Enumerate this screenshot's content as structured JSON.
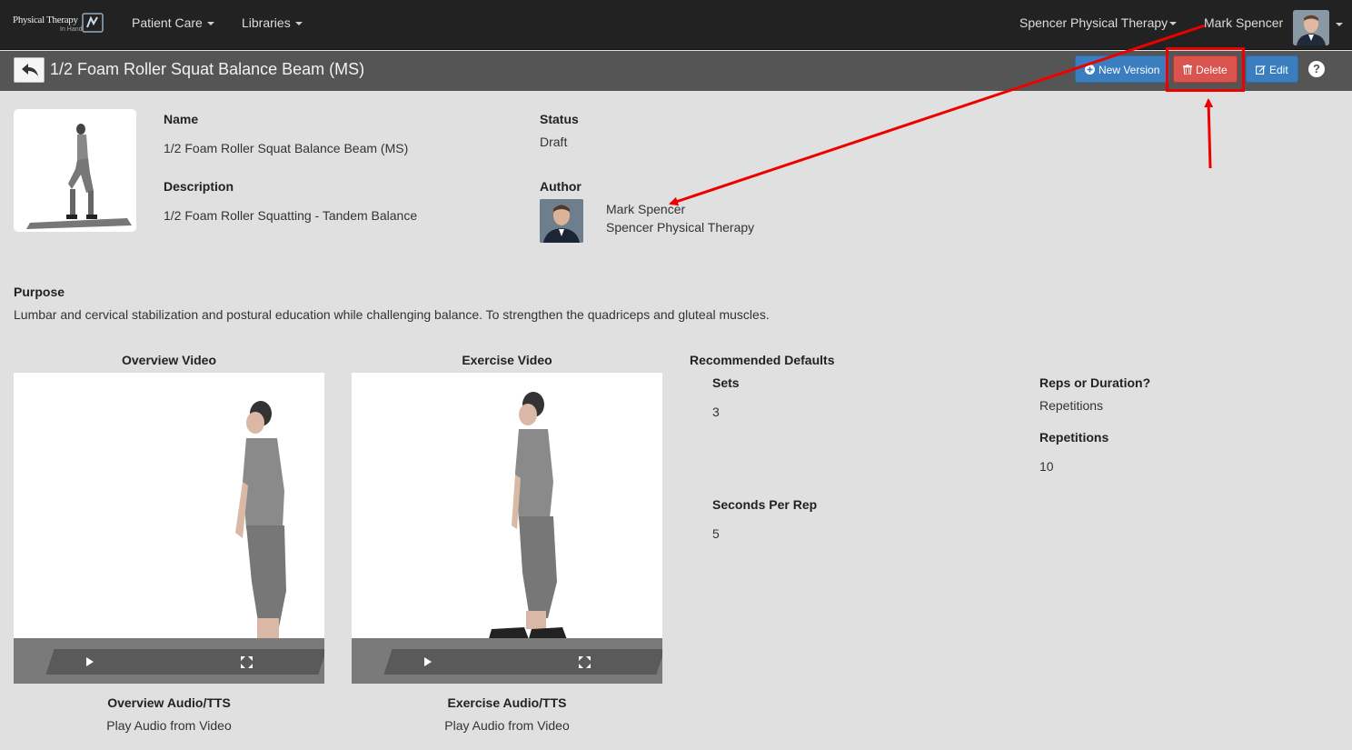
{
  "navbar": {
    "logo_text": "Physical Therapy",
    "logo_sub": "In Hand",
    "patient_care": "Patient Care",
    "libraries": "Libraries",
    "clinic": "Spencer Physical Therapy",
    "user": "Mark Spencer"
  },
  "titlebar": {
    "title": "1/2 Foam Roller Squat Balance Beam (MS)",
    "new_version": "New Version",
    "delete": "Delete",
    "edit": "Edit",
    "help": "?"
  },
  "details": {
    "name_label": "Name",
    "name_value": "1/2 Foam Roller Squat Balance Beam (MS)",
    "description_label": "Description",
    "description_value": "1/2 Foam Roller Squatting - Tandem Balance",
    "status_label": "Status",
    "status_value": "Draft",
    "author_label": "Author",
    "author_name": "Mark Spencer",
    "author_org": "Spencer Physical Therapy"
  },
  "purpose": {
    "label": "Purpose",
    "text": "Lumbar and cervical stabilization and postural education while challenging balance. To strengthen the quadriceps and gluteal muscles."
  },
  "videos": {
    "overview_title": "Overview Video",
    "exercise_title": "Exercise Video",
    "overview_audio_label": "Overview Audio/TTS",
    "overview_audio_value": "Play Audio from Video",
    "exercise_audio_label": "Exercise Audio/TTS",
    "exercise_audio_value": "Play Audio from Video"
  },
  "defaults": {
    "title": "Recommended Defaults",
    "sets_label": "Sets",
    "sets_value": "3",
    "seconds_label": "Seconds Per Rep",
    "seconds_value": "5",
    "reps_or_duration_label": "Reps or Duration?",
    "reps_or_duration_value": "Repetitions",
    "repetitions_label": "Repetitions",
    "repetitions_value": "10"
  },
  "colors": {
    "navbar_bg": "#222222",
    "titlebar_bg": "#555555",
    "primary": "#3a7ec0",
    "danger": "#d9534f",
    "annotation": "#ee0000"
  }
}
